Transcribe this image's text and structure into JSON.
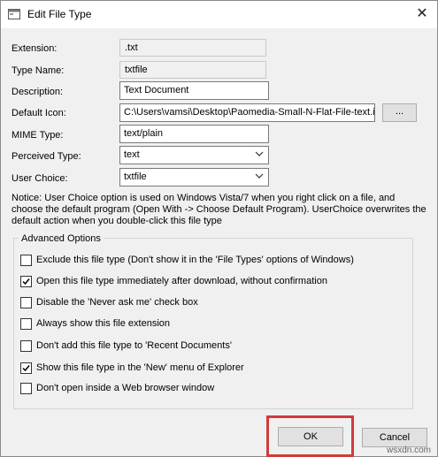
{
  "window": {
    "title": "Edit File Type",
    "close_glyph": "✕"
  },
  "fields": {
    "extension": {
      "label": "Extension:",
      "value": ".txt"
    },
    "type_name": {
      "label": "Type Name:",
      "value": "txtfile"
    },
    "description": {
      "label": "Description:",
      "value": "Text Document"
    },
    "default_icon": {
      "label": "Default Icon:",
      "value": "C:\\Users\\vamsi\\Desktop\\Paomedia-Small-N-Flat-File-text.ic",
      "browse_label": "..."
    },
    "mime_type": {
      "label": "MIME Type:",
      "value": "text/plain"
    },
    "perceived_type": {
      "label": "Perceived Type:",
      "value": "text"
    },
    "user_choice": {
      "label": "User Choice:",
      "value": "txtfile"
    }
  },
  "notice": "Notice: User Choice option is used on Windows Vista/7 when you right click on a file, and choose the default program (Open With -> Choose Default Program). UserChoice overwrites the default action when you double-click this file type",
  "advanced": {
    "title": "Advanced Options",
    "options": [
      {
        "label": "Exclude  this file type (Don't show it in the 'File Types' options of Windows)",
        "checked": false
      },
      {
        "label": "Open this file type immediately after download, without confirmation",
        "checked": true
      },
      {
        "label": "Disable the 'Never ask me' check box",
        "checked": false
      },
      {
        "label": "Always show this file extension",
        "checked": false
      },
      {
        "label": "Don't add this file type to 'Recent Documents'",
        "checked": false
      },
      {
        "label": "Show this file type in the 'New' menu of Explorer",
        "checked": true
      },
      {
        "label": "Don't open inside a Web browser window",
        "checked": false
      }
    ]
  },
  "buttons": {
    "ok": "OK",
    "cancel": "Cancel"
  },
  "watermark": "wsxdn.com",
  "colors": {
    "highlight": "#d13b3b",
    "window_bg": "#f0f0f0"
  }
}
